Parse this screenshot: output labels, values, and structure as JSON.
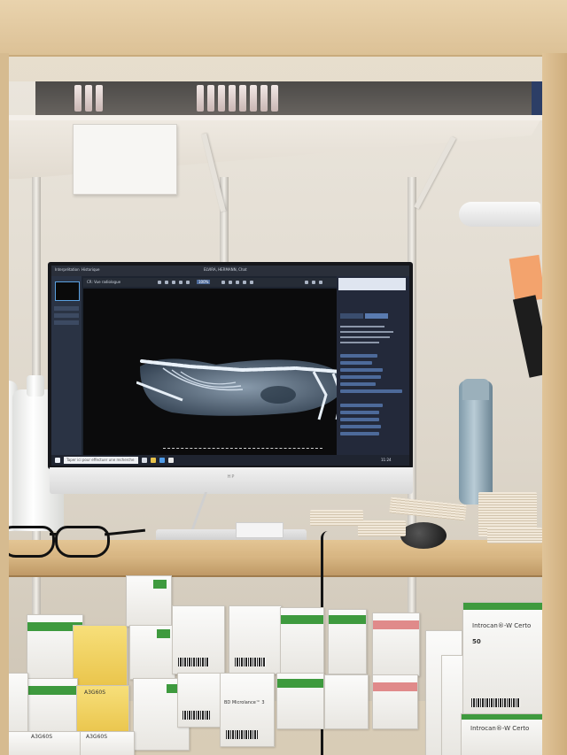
{
  "screen": {
    "app_menu": [
      "Interprétation",
      "Historique"
    ],
    "window_title": "ELVIRA, HERMANN, Chat",
    "patient_tab": "CR: Vue radiologue",
    "zoom_value": "100%",
    "taskbar_search": "Taper ici pour effectuer une recherche",
    "taskbar_clock": "11:24",
    "colors": {
      "accent": "#4d6a9a",
      "highlight": "#5aa0e0"
    }
  },
  "monitor": {
    "brand": "HP"
  },
  "boxes": {
    "introcan_label": "Introcan®-W Certo",
    "introcan_count": "50",
    "handwritten": [
      "A3G60S",
      "A3G60S",
      "A3G60S"
    ],
    "bd_label": "BD Microlance™ 3"
  },
  "icons": [
    "windows-start-icon",
    "search-icon",
    "folder-icon",
    "browser-icon",
    "zoom-icon",
    "rotate-icon",
    "measure-icon"
  ]
}
